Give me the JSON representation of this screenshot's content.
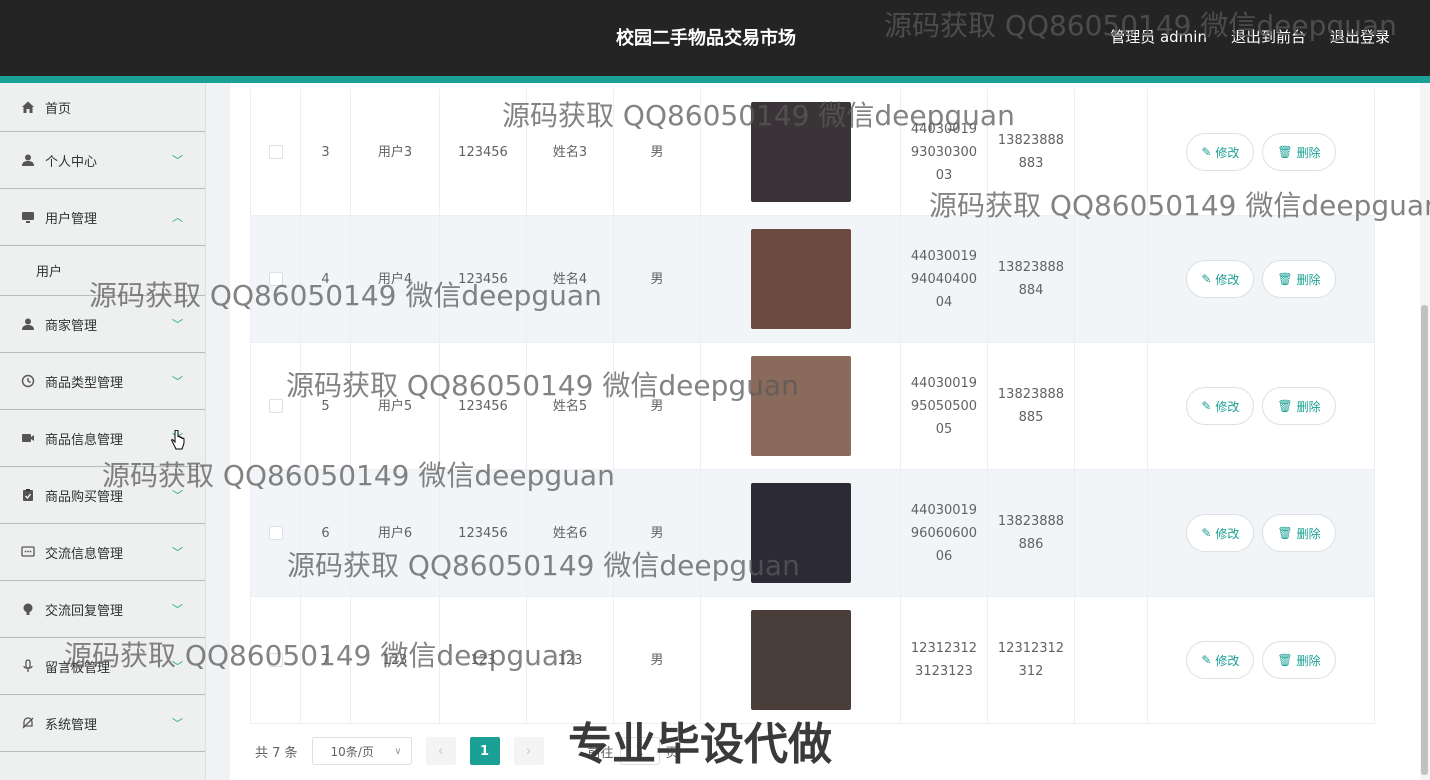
{
  "header": {
    "title": "校园二手物品交易市场",
    "user": "管理员 admin",
    "to_front": "退出到前台",
    "logout": "退出登录"
  },
  "sidebar": {
    "items": [
      {
        "label": "首页",
        "icon": "home-icon",
        "arrow": ""
      },
      {
        "label": "个人中心",
        "icon": "user-icon",
        "arrow": "down"
      },
      {
        "label": "用户管理",
        "icon": "monitor-icon",
        "arrow": "up"
      },
      {
        "label": "用户",
        "icon": "",
        "arrow": ""
      },
      {
        "label": "商家管理",
        "icon": "person-icon",
        "arrow": "down"
      },
      {
        "label": "商品类型管理",
        "icon": "clock-icon",
        "arrow": "down"
      },
      {
        "label": "商品信息管理",
        "icon": "video-icon",
        "arrow": "down"
      },
      {
        "label": "商品购买管理",
        "icon": "clipboard-icon",
        "arrow": "down"
      },
      {
        "label": "交流信息管理",
        "icon": "chat-icon",
        "arrow": "down"
      },
      {
        "label": "交流回复管理",
        "icon": "bulb-icon",
        "arrow": "down"
      },
      {
        "label": "留言板管理",
        "icon": "mic-icon",
        "arrow": "down"
      },
      {
        "label": "系统管理",
        "icon": "bell-off-icon",
        "arrow": "down"
      }
    ]
  },
  "table": {
    "rows": [
      {
        "idx": "3",
        "account": "用户3",
        "password": "123456",
        "name": "姓名3",
        "sex": "男",
        "id_no": "440300199303030003",
        "phone": "13823888883",
        "photo_color": "#3a3438"
      },
      {
        "idx": "4",
        "account": "用户4",
        "password": "123456",
        "name": "姓名4",
        "sex": "男",
        "id_no": "440300199404040004",
        "phone": "13823888884",
        "photo_color": "#6b4a42"
      },
      {
        "idx": "5",
        "account": "用户5",
        "password": "123456",
        "name": "姓名5",
        "sex": "男",
        "id_no": "440300199505050005",
        "phone": "13823888885",
        "photo_color": "#8a6a5a"
      },
      {
        "idx": "6",
        "account": "用户6",
        "password": "123456",
        "name": "姓名6",
        "sex": "男",
        "id_no": "440300199606060006",
        "phone": "13823888886",
        "photo_color": "#2c2a34"
      },
      {
        "idx": "7",
        "account": "123",
        "password": "123",
        "name": "123",
        "sex": "男",
        "id_no": "123123123123123",
        "phone": "12312312312",
        "photo_color": "#4a3e3a"
      }
    ],
    "edit_label": "修改",
    "delete_label": "删除"
  },
  "pagination": {
    "total": "共 7 条",
    "page_size": "10条/页",
    "current": "1",
    "goto_prefix": "前往",
    "goto_value": "1",
    "goto_suffix": "页"
  },
  "watermarks": {
    "text": "源码获取 QQ86050149 微信deepguan",
    "big": "专业毕设代做"
  },
  "colors": {
    "accent": "#1aa094",
    "header": "#242424"
  }
}
